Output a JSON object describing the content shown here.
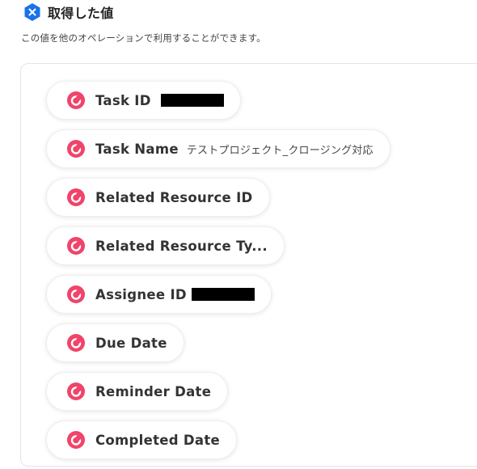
{
  "header": {
    "title": "取得した値",
    "icon": "hexagon-x-icon",
    "icon_color": "#1a73e8"
  },
  "subtitle": "この値を他のオペレーションで利用することができます。",
  "brand_icon": {
    "name": "app-logo-icon",
    "color": "#f0446a"
  },
  "fields": [
    {
      "label": "Task ID",
      "value": "",
      "redacted": true
    },
    {
      "label": "Task Name",
      "value": "テストプロジェクト_クロージング対応",
      "redacted": false
    },
    {
      "label": "Related Resource ID",
      "value": "",
      "redacted": false
    },
    {
      "label": "Related Resource Ty...",
      "value": "",
      "redacted": false
    },
    {
      "label": "Assignee ID",
      "value": "",
      "redacted": true
    },
    {
      "label": "Due Date",
      "value": "",
      "redacted": false
    },
    {
      "label": "Reminder Date",
      "value": "",
      "redacted": false
    },
    {
      "label": "Completed Date",
      "value": "",
      "redacted": false
    }
  ]
}
